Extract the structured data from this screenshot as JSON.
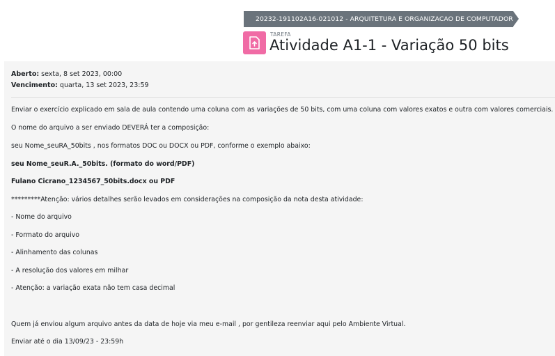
{
  "breadcrumb": "20232-191102A16-021012 - ARQUITETURA E ORGANIZACAO DE COMPUTADOR",
  "header": {
    "kind": "TAREFA",
    "title": "Atividade A1-1 - Variação 50 bits",
    "icon": "upload-file-icon",
    "icon_color": "#f06ba5"
  },
  "dates": {
    "opened_label": "Aberto:",
    "opened_value": " sexta, 8 set 2023, 00:00",
    "due_label": "Vencimento:",
    "due_value": " quarta, 13 set 2023, 23:59"
  },
  "description": [
    "Enviar o exercício explicado em sala de aula contendo uma coluna com as variações de 50 bits, com uma coluna com valores exatos e outra com valores comerciais.",
    "O nome do arquivo a ser enviado DEVERÁ ter a composição:",
    "seu Nome_seuRA_50bits ,  nos formatos DOC ou DOCX ou PDF, conforme o exemplo abaixo:",
    " seu Nome_seuR.A._50bits. (formato do word/PDF)",
    " Fulano Cicrano_1234567_50bits.docx  ou  PDF",
    "*********Atenção: vários detalhes serão levados em considerações na composição da nota desta atividade:",
    "- Nome do arquivo",
    "- Formato do arquivo",
    "- Alinhamento das colunas",
    "- A resolução dos valores em milhar",
    "- Atenção: a variação exata não tem casa decimal",
    "Quem já enviou algum arquivo antes da data de hoje via meu e-mail , por gentileza reenviar aqui pelo Ambiente Virtual.",
    "Enviar até o dia 13/09/23 - 23:59h"
  ]
}
